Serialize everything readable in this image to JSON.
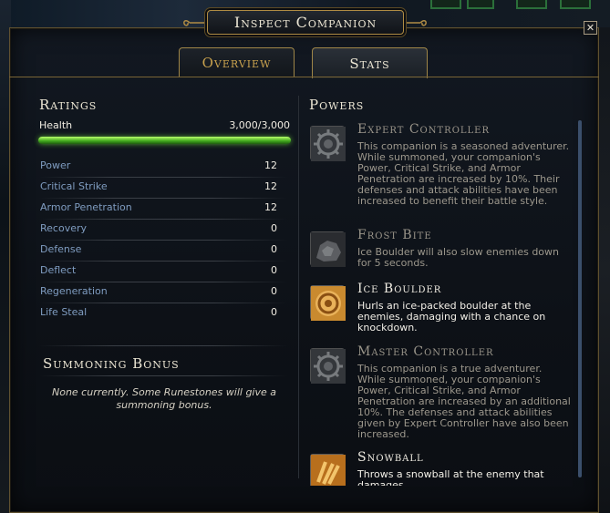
{
  "window": {
    "title": "Inspect Companion",
    "close_glyph": "✕"
  },
  "tabs": [
    {
      "label": "Overview",
      "selected": false
    },
    {
      "label": "Stats",
      "selected": true
    }
  ],
  "ratings": {
    "heading": "Ratings",
    "health": {
      "label": "Health",
      "value": "3,000/3,000",
      "fill": 1.0
    },
    "stats": [
      {
        "label": "Power",
        "value": "12"
      },
      {
        "label": "Critical Strike",
        "value": "12"
      },
      {
        "label": "Armor Penetration",
        "value": "12"
      },
      {
        "label": "Recovery",
        "value": "0"
      },
      {
        "label": "Defense",
        "value": "0"
      },
      {
        "label": "Deflect",
        "value": "0"
      },
      {
        "label": "Regeneration",
        "value": "0"
      },
      {
        "label": "Life Steal",
        "value": "0"
      }
    ]
  },
  "summoning_bonus": {
    "heading": "Summoning Bonus",
    "text": "None currently. Some Runestones will give a summoning bonus."
  },
  "powers": {
    "heading": "Powers",
    "items": [
      {
        "title": "Expert Controller",
        "state": "inactive",
        "icon": "gear-emblem-icon",
        "desc": "This companion is a seasoned adventurer. While summoned, your companion's Power, Critical Strike, and Armor Penetration are increased by 10%. Their defenses and attack abilities have been increased to benefit their battle style."
      },
      {
        "title": "Frost Bite",
        "state": "inactive",
        "icon": "rock-icon",
        "desc": "Ice Boulder will also slow enemies down for 5 seconds."
      },
      {
        "title": "Ice Boulder",
        "state": "active",
        "icon": "swirl-boulder-icon",
        "desc": "Hurls an ice-packed boulder at the enemies, damaging with a chance on knockdown."
      },
      {
        "title": "Master Controller",
        "state": "inactive",
        "icon": "gear-emblem-icon",
        "desc": "This companion is a true adventurer. While summoned, your companion's Power, Critical Strike, and Armor Penetration are increased by an additional 10%. The defenses and attack abilities given by Expert Controller have also been increased."
      },
      {
        "title": "Snowball",
        "state": "active",
        "icon": "snowball-icon",
        "desc": "Throws a snowball at the enemy that damages"
      }
    ]
  },
  "colors": {
    "accent_gold": "#c9a24e",
    "stat_label_blue": "#7f9cc0",
    "health_green": "#3fa51d"
  }
}
